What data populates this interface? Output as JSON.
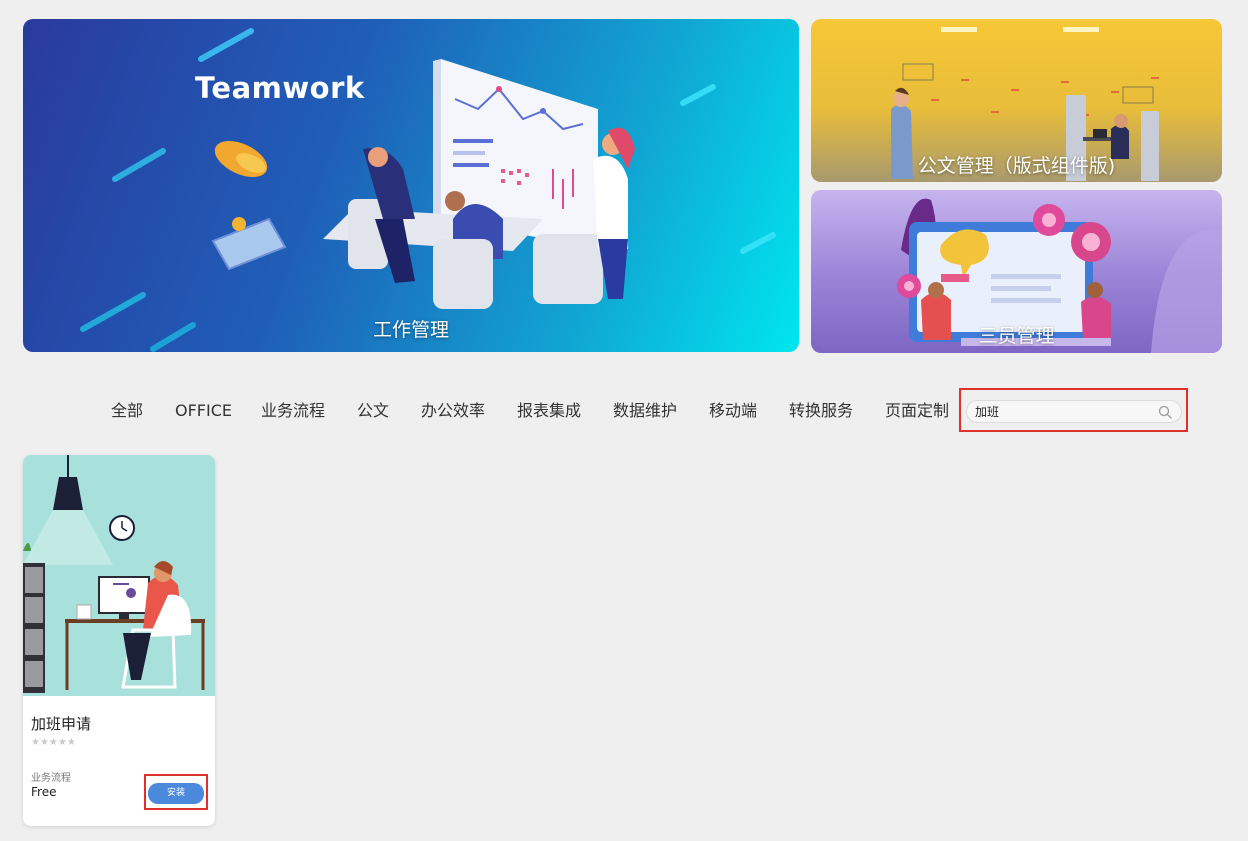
{
  "banners": {
    "main": {
      "title": "工作管理",
      "art_text": "Teamwork"
    },
    "doc": {
      "title": "公文管理（版式组件版)"
    },
    "three": {
      "title": "三员管理"
    }
  },
  "categories": [
    {
      "label": "全部"
    },
    {
      "label": "OFFICE"
    },
    {
      "label": "业务流程"
    },
    {
      "label": "公文"
    },
    {
      "label": "办公效率"
    },
    {
      "label": "报表集成"
    },
    {
      "label": "数据维护"
    },
    {
      "label": "移动端"
    },
    {
      "label": "转换服务"
    },
    {
      "label": "页面定制"
    }
  ],
  "search": {
    "value": "加班",
    "icon": "search-icon"
  },
  "apps": [
    {
      "title": "加班申请",
      "rating": 0,
      "stars": "★★★★★",
      "category": "业务流程",
      "price": "Free",
      "install_label": "安装"
    }
  ],
  "colors": {
    "accent": "#4a89dc",
    "highlight": "#e0302a"
  }
}
